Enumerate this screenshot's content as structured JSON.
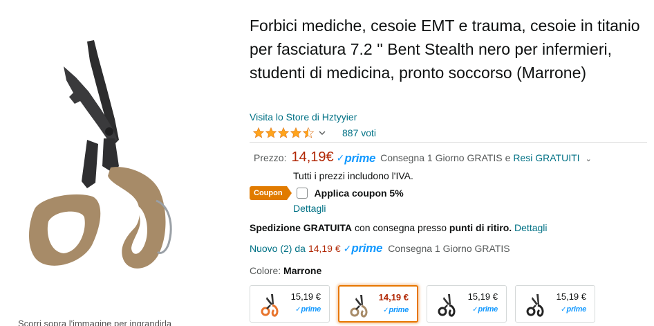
{
  "product": {
    "title": "Forbici mediche, cesoie EMT e trauma, cesoie in titanio per fasciatura 7.2 '' Bent Stealth nero per infermieri, studenti di medicina, pronto soccorso (Marrone)",
    "store_link": "Visita lo Store di Hztyyier",
    "rating": 4.5,
    "rating_count": "887 voti",
    "zoom_hint": "Scorri sopra l'immagine per ingrandirla"
  },
  "pricing": {
    "label": "Prezzo:",
    "price": "14,19€",
    "prime_check": "✓",
    "prime_word": "prime",
    "delivery": "Consegna 1 Giorno GRATIS",
    "returns_pre": "e",
    "returns_link": "Resi GRATUITI",
    "vat_note": "Tutti i prezzi includono l'IVA."
  },
  "coupon": {
    "badge": "Coupon",
    "label": "Applica coupon 5%",
    "details_link": "Dettagli"
  },
  "shipping": {
    "bold1": "Spedizione GRATUITA",
    "text": "con consegna presso",
    "bold2": "punti di ritiro.",
    "link": "Dettagli"
  },
  "offers": {
    "link": "Nuovo (2) da",
    "price": "14,19 €",
    "delivery": "Consegna 1 Giorno GRATIS"
  },
  "color": {
    "label": "Colore:",
    "value": "Marrone"
  },
  "swatches": [
    {
      "price": "15,19 €",
      "handle_color": "#e8742c",
      "selected": false
    },
    {
      "price": "14,19 €",
      "handle_color": "#a78b68",
      "selected": true
    },
    {
      "price": "15,19 €",
      "handle_color": "#222222",
      "selected": false
    },
    {
      "price": "15,19 €",
      "handle_color": "#222222",
      "selected": false
    }
  ],
  "colors": {
    "link": "#007185",
    "price": "#b12704",
    "prime": "#1399ff",
    "coupon": "#e17b00",
    "handle": "#a78b68",
    "star": "#ffa41c"
  },
  "icons": [
    "scissors-image",
    "star-icon",
    "chevron-down-icon",
    "prime-check-icon",
    "checkbox"
  ]
}
